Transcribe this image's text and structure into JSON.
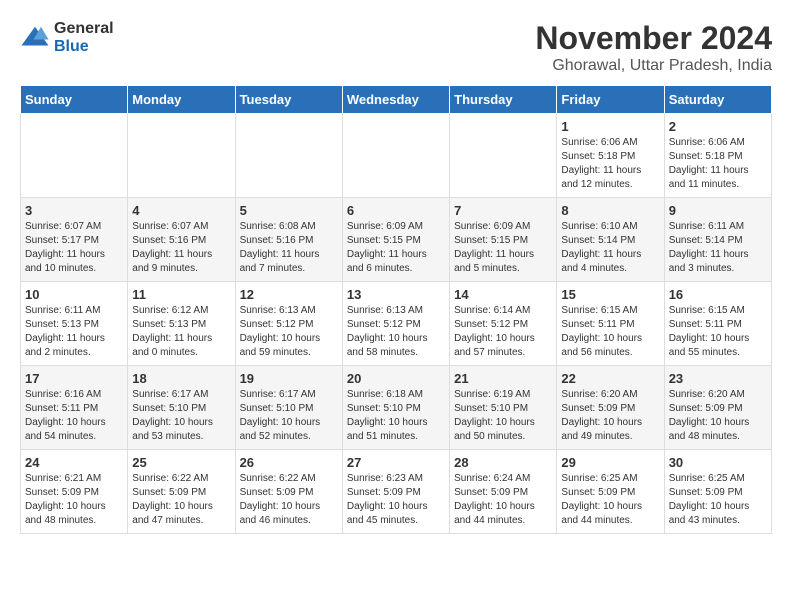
{
  "logo": {
    "general": "General",
    "blue": "Blue"
  },
  "title": "November 2024",
  "subtitle": "Ghorawal, Uttar Pradesh, India",
  "days_header": [
    "Sunday",
    "Monday",
    "Tuesday",
    "Wednesday",
    "Thursday",
    "Friday",
    "Saturday"
  ],
  "weeks": [
    [
      {
        "day": "",
        "info": ""
      },
      {
        "day": "",
        "info": ""
      },
      {
        "day": "",
        "info": ""
      },
      {
        "day": "",
        "info": ""
      },
      {
        "day": "",
        "info": ""
      },
      {
        "day": "1",
        "info": "Sunrise: 6:06 AM\nSunset: 5:18 PM\nDaylight: 11 hours and 12 minutes."
      },
      {
        "day": "2",
        "info": "Sunrise: 6:06 AM\nSunset: 5:18 PM\nDaylight: 11 hours and 11 minutes."
      }
    ],
    [
      {
        "day": "3",
        "info": "Sunrise: 6:07 AM\nSunset: 5:17 PM\nDaylight: 11 hours and 10 minutes."
      },
      {
        "day": "4",
        "info": "Sunrise: 6:07 AM\nSunset: 5:16 PM\nDaylight: 11 hours and 9 minutes."
      },
      {
        "day": "5",
        "info": "Sunrise: 6:08 AM\nSunset: 5:16 PM\nDaylight: 11 hours and 7 minutes."
      },
      {
        "day": "6",
        "info": "Sunrise: 6:09 AM\nSunset: 5:15 PM\nDaylight: 11 hours and 6 minutes."
      },
      {
        "day": "7",
        "info": "Sunrise: 6:09 AM\nSunset: 5:15 PM\nDaylight: 11 hours and 5 minutes."
      },
      {
        "day": "8",
        "info": "Sunrise: 6:10 AM\nSunset: 5:14 PM\nDaylight: 11 hours and 4 minutes."
      },
      {
        "day": "9",
        "info": "Sunrise: 6:11 AM\nSunset: 5:14 PM\nDaylight: 11 hours and 3 minutes."
      }
    ],
    [
      {
        "day": "10",
        "info": "Sunrise: 6:11 AM\nSunset: 5:13 PM\nDaylight: 11 hours and 2 minutes."
      },
      {
        "day": "11",
        "info": "Sunrise: 6:12 AM\nSunset: 5:13 PM\nDaylight: 11 hours and 0 minutes."
      },
      {
        "day": "12",
        "info": "Sunrise: 6:13 AM\nSunset: 5:12 PM\nDaylight: 10 hours and 59 minutes."
      },
      {
        "day": "13",
        "info": "Sunrise: 6:13 AM\nSunset: 5:12 PM\nDaylight: 10 hours and 58 minutes."
      },
      {
        "day": "14",
        "info": "Sunrise: 6:14 AM\nSunset: 5:12 PM\nDaylight: 10 hours and 57 minutes."
      },
      {
        "day": "15",
        "info": "Sunrise: 6:15 AM\nSunset: 5:11 PM\nDaylight: 10 hours and 56 minutes."
      },
      {
        "day": "16",
        "info": "Sunrise: 6:15 AM\nSunset: 5:11 PM\nDaylight: 10 hours and 55 minutes."
      }
    ],
    [
      {
        "day": "17",
        "info": "Sunrise: 6:16 AM\nSunset: 5:11 PM\nDaylight: 10 hours and 54 minutes."
      },
      {
        "day": "18",
        "info": "Sunrise: 6:17 AM\nSunset: 5:10 PM\nDaylight: 10 hours and 53 minutes."
      },
      {
        "day": "19",
        "info": "Sunrise: 6:17 AM\nSunset: 5:10 PM\nDaylight: 10 hours and 52 minutes."
      },
      {
        "day": "20",
        "info": "Sunrise: 6:18 AM\nSunset: 5:10 PM\nDaylight: 10 hours and 51 minutes."
      },
      {
        "day": "21",
        "info": "Sunrise: 6:19 AM\nSunset: 5:10 PM\nDaylight: 10 hours and 50 minutes."
      },
      {
        "day": "22",
        "info": "Sunrise: 6:20 AM\nSunset: 5:09 PM\nDaylight: 10 hours and 49 minutes."
      },
      {
        "day": "23",
        "info": "Sunrise: 6:20 AM\nSunset: 5:09 PM\nDaylight: 10 hours and 48 minutes."
      }
    ],
    [
      {
        "day": "24",
        "info": "Sunrise: 6:21 AM\nSunset: 5:09 PM\nDaylight: 10 hours and 48 minutes."
      },
      {
        "day": "25",
        "info": "Sunrise: 6:22 AM\nSunset: 5:09 PM\nDaylight: 10 hours and 47 minutes."
      },
      {
        "day": "26",
        "info": "Sunrise: 6:22 AM\nSunset: 5:09 PM\nDaylight: 10 hours and 46 minutes."
      },
      {
        "day": "27",
        "info": "Sunrise: 6:23 AM\nSunset: 5:09 PM\nDaylight: 10 hours and 45 minutes."
      },
      {
        "day": "28",
        "info": "Sunrise: 6:24 AM\nSunset: 5:09 PM\nDaylight: 10 hours and 44 minutes."
      },
      {
        "day": "29",
        "info": "Sunrise: 6:25 AM\nSunset: 5:09 PM\nDaylight: 10 hours and 44 minutes."
      },
      {
        "day": "30",
        "info": "Sunrise: 6:25 AM\nSunset: 5:09 PM\nDaylight: 10 hours and 43 minutes."
      }
    ]
  ]
}
